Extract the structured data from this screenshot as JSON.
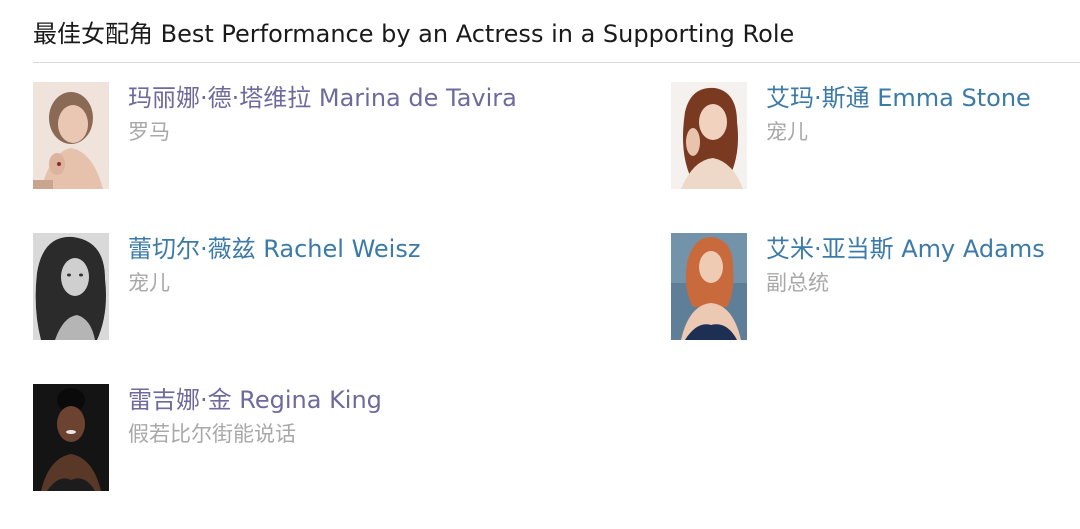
{
  "section": {
    "title": "最佳女配角 Best Performance by an Actress in a Supporting Role"
  },
  "nominees": [
    {
      "name": "玛丽娜·德·塔维拉 Marina de Tavira",
      "film": "罗马"
    },
    {
      "name": "艾玛·斯通 Emma Stone",
      "film": "宠儿"
    },
    {
      "name": "蕾切尔·薇兹 Rachel Weisz",
      "film": "宠儿"
    },
    {
      "name": "艾米·亚当斯 Amy Adams",
      "film": "副总统"
    },
    {
      "name": "雷吉娜·金 Regina King",
      "film": "假若比尔街能说话"
    }
  ],
  "colors": {
    "visited_link": "#6e6a9e",
    "link": "#3c7aa8",
    "film_text": "#a8a8a8",
    "title_text": "#1a1a1a",
    "divider": "#d9d9d9"
  }
}
